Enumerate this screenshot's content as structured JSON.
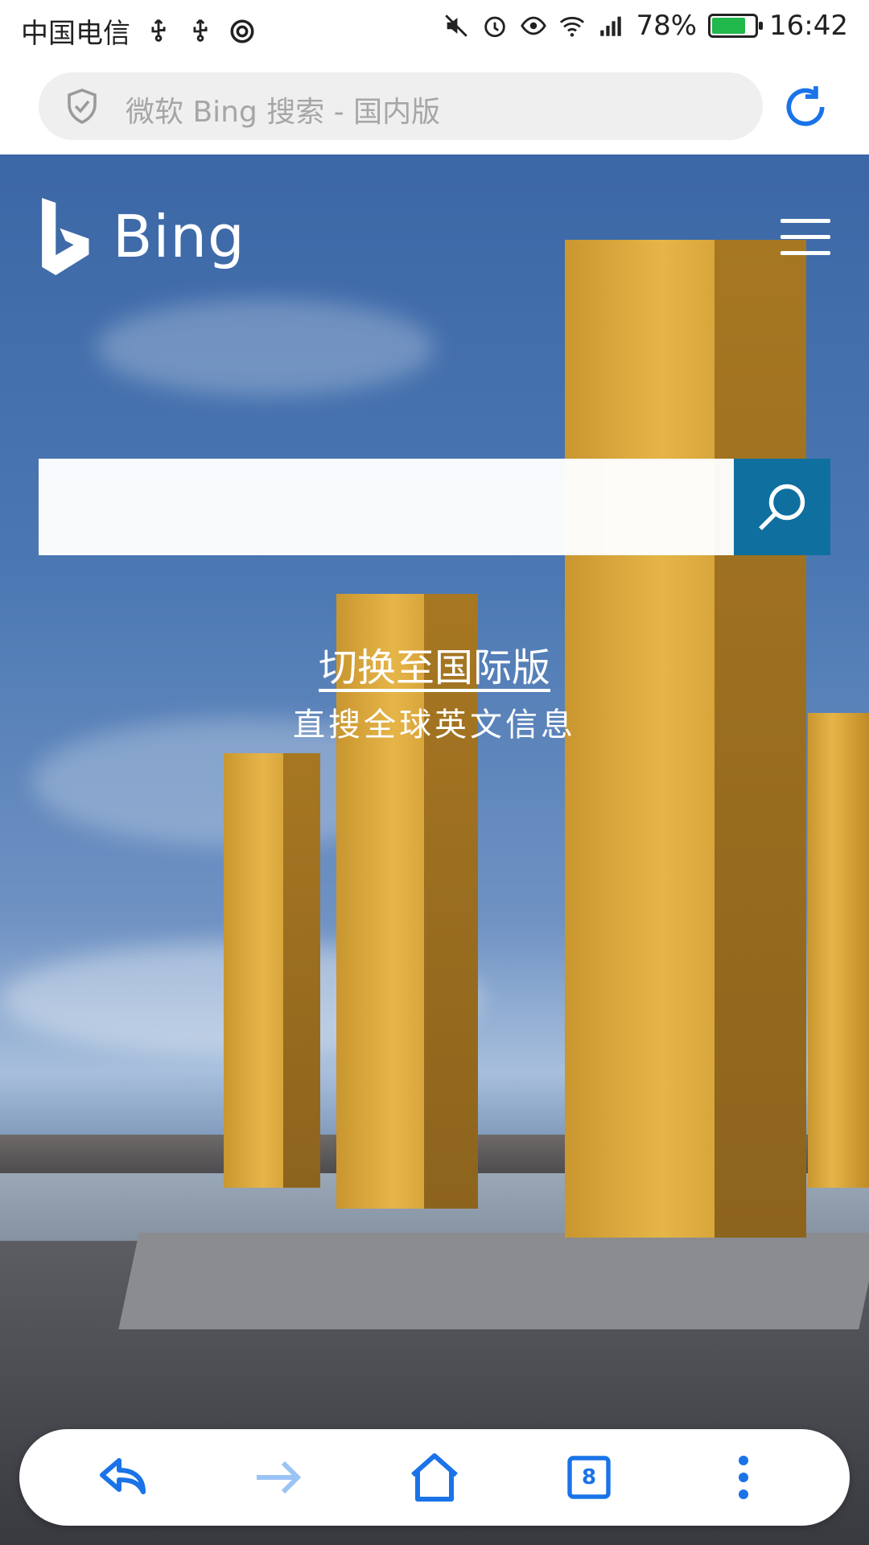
{
  "status_bar": {
    "carrier": "中国电信",
    "battery_percent": "78%",
    "battery_level": 0.78,
    "time": "16:42",
    "icons": [
      "usb-icon",
      "usb-icon",
      "sync-icon",
      "mute-icon",
      "alarm-icon",
      "eye-icon",
      "wifi-icon",
      "signal-icon",
      "battery-icon"
    ]
  },
  "address_bar": {
    "url_text": "微软 Bing 搜索 - 国内版",
    "accent": "#1a73e8"
  },
  "page": {
    "logo_text": "Bing",
    "search_placeholder": "",
    "switch_label": "切换至国际版",
    "switch_subtitle": "直搜全球英文信息",
    "search_button_color": "#0f6f9f"
  },
  "bottom_nav": {
    "tabs_count": "8",
    "items": [
      "back-icon",
      "forward-icon",
      "home-icon",
      "tabs-icon",
      "more-icon"
    ]
  }
}
